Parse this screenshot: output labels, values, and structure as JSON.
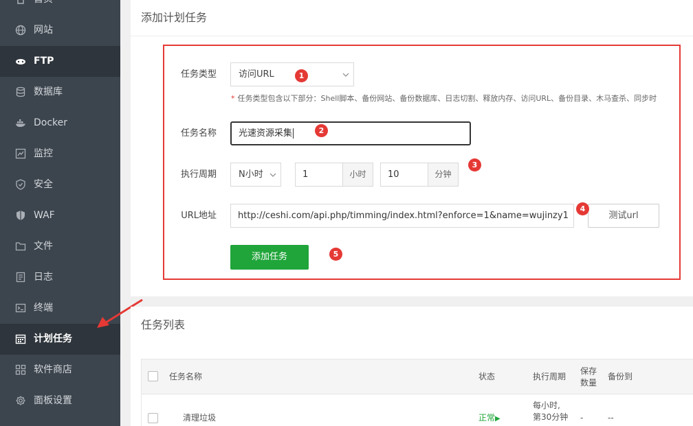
{
  "sidebar": {
    "items": [
      {
        "label": "首页",
        "icon": "home-icon"
      },
      {
        "label": "网站",
        "icon": "globe-icon"
      },
      {
        "label": "FTP",
        "icon": "ftp-icon"
      },
      {
        "label": "数据库",
        "icon": "database-icon"
      },
      {
        "label": "Docker",
        "icon": "docker-icon"
      },
      {
        "label": "监控",
        "icon": "monitor-icon"
      },
      {
        "label": "安全",
        "icon": "shield-icon"
      },
      {
        "label": "WAF",
        "icon": "waf-shield-icon"
      },
      {
        "label": "文件",
        "icon": "folder-icon"
      },
      {
        "label": "日志",
        "icon": "log-icon"
      },
      {
        "label": "终端",
        "icon": "terminal-icon"
      },
      {
        "label": "计划任务",
        "icon": "calendar-icon"
      },
      {
        "label": "软件商店",
        "icon": "grid-icon"
      },
      {
        "label": "面板设置",
        "icon": "gear-icon"
      }
    ]
  },
  "form": {
    "title": "添加计划任务",
    "task_type_label": "任务类型",
    "task_type_value": "访问URL",
    "hint": "任务类型包含以下部分：Shell脚本、备份网站、备份数据库、日志切割、释放内存、访问URL、备份目录、木马查杀、同步时",
    "task_name_label": "任务名称",
    "task_name_value": "光速资源采集",
    "period_label": "执行周期",
    "period_value": "N小时",
    "hours_value": "1",
    "hours_unit": "小时",
    "minutes_value": "10",
    "minutes_unit": "分钟",
    "url_label": "URL地址",
    "url_value": "http://ceshi.com/api.php/timming/index.html?enforce=1&name=wujinzy1",
    "test_button": "测试url",
    "add_button": "添加任务",
    "badges": [
      "1",
      "2",
      "3",
      "4",
      "5"
    ]
  },
  "list": {
    "title": "任务列表",
    "columns": {
      "name": "任务名称",
      "status": "状态",
      "period": "执行周期",
      "save_line1": "保存",
      "save_line2": "数量",
      "backup": "备份到"
    },
    "rows": [
      {
        "name": "清理垃圾",
        "status": "正常",
        "period_line1": "每小时,",
        "period_line2": "第30分钟",
        "save": "-",
        "backup": "--"
      }
    ]
  },
  "colors": {
    "accent": "#20a53a",
    "annotation": "#e53935",
    "sidebar": "#3c444d"
  }
}
